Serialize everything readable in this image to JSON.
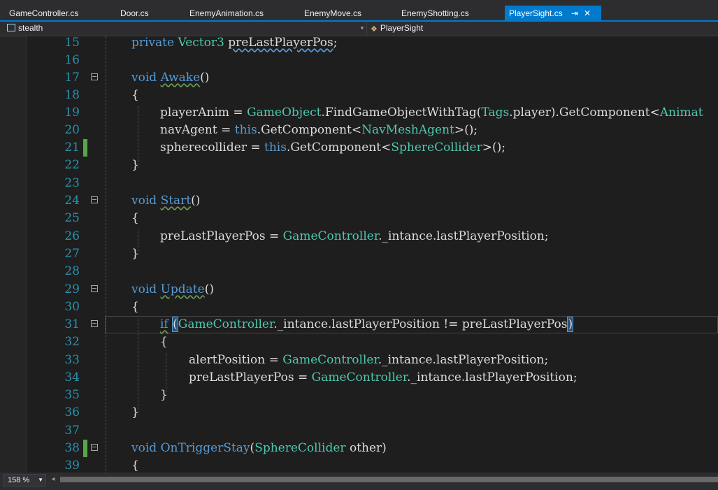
{
  "tabs": [
    {
      "label": "GameController.cs",
      "active": false
    },
    {
      "label": "Door.cs",
      "active": false
    },
    {
      "label": "EnemyAnimation.cs",
      "active": false
    },
    {
      "label": "EnemyMove.cs",
      "active": false
    },
    {
      "label": "EnemyShotting.cs",
      "active": false
    },
    {
      "label": "PlayerSight.cs",
      "active": true
    }
  ],
  "tab_icons": {
    "pin": "pin-icon",
    "close": "close-icon"
  },
  "navbar": {
    "project": "stealth",
    "class": "PlayerSight",
    "project_icon": "csharp-project-icon",
    "class_icon": "class-icon"
  },
  "code_lines": [
    {
      "n": "15"
    },
    {
      "n": "16"
    },
    {
      "n": "17"
    },
    {
      "n": "18"
    },
    {
      "n": "19"
    },
    {
      "n": "20"
    },
    {
      "n": "21"
    },
    {
      "n": "22"
    },
    {
      "n": "23"
    },
    {
      "n": "24"
    },
    {
      "n": "25"
    },
    {
      "n": "26"
    },
    {
      "n": "27"
    },
    {
      "n": "28"
    },
    {
      "n": "29"
    },
    {
      "n": "30"
    },
    {
      "n": "31"
    },
    {
      "n": "32"
    },
    {
      "n": "33"
    },
    {
      "n": "34"
    },
    {
      "n": "35"
    },
    {
      "n": "36"
    },
    {
      "n": "37"
    },
    {
      "n": "38"
    },
    {
      "n": "39"
    }
  ],
  "code": {
    "l15": {
      "kw": "private",
      "ty": "Vector3",
      "name": "preLastPlayerPos",
      "end": ";"
    },
    "l17": {
      "kw": "void",
      "method": "Awake",
      "args": "()"
    },
    "l18": "{",
    "l19": {
      "a": "playerAnim = ",
      "b": "GameObject",
      "c": ".FindGameObjectWithTag(",
      "d": "Tags",
      "e": ".player).GetComponent<",
      "f": "Animat"
    },
    "l20": {
      "a": "navAgent = ",
      "kw": "this",
      "b": ".GetComponent<",
      "ty": "NavMeshAgent",
      "c": ">();"
    },
    "l21": {
      "a": "spherecollider = ",
      "kw": "this",
      "b": ".GetComponent<",
      "ty": "SphereCollider",
      "c": ">();"
    },
    "l22": "}",
    "l24": {
      "kw": "void",
      "method": "Start",
      "args": "()"
    },
    "l25": "{",
    "l26": {
      "a": "preLastPlayerPos = ",
      "ty": "GameController",
      "b": "._intance.lastPlayerPosition;"
    },
    "l27": "}",
    "l29": {
      "kw": "void",
      "method": "Update",
      "args": "()"
    },
    "l30": "{",
    "l31": {
      "kw": "if",
      "p": "(",
      "ty": "GameController",
      "b": "._intance.lastPlayerPosition != preLastPlayerPos",
      "q": ")"
    },
    "l32": "{",
    "l33": {
      "a": "alertPosition = ",
      "ty": "GameController",
      "b": "._intance.lastPlayerPosition;"
    },
    "l34": {
      "a": "preLastPlayerPos = ",
      "ty": "GameController",
      "b": "._intance.lastPlayerPosition;"
    },
    "l35": "}",
    "l36": "}",
    "l38": {
      "kw": "void",
      "method": "OnTriggerStay",
      "p": "(",
      "ty": "SphereCollider",
      "b": " other)"
    },
    "l39": "{"
  },
  "zoom": "158 %",
  "colors": {
    "keyword": "#569cd6",
    "type": "#4ec9b0",
    "line_number": "#2b91af",
    "change_marker": "#57a64a",
    "active_tab": "#007acc"
  }
}
